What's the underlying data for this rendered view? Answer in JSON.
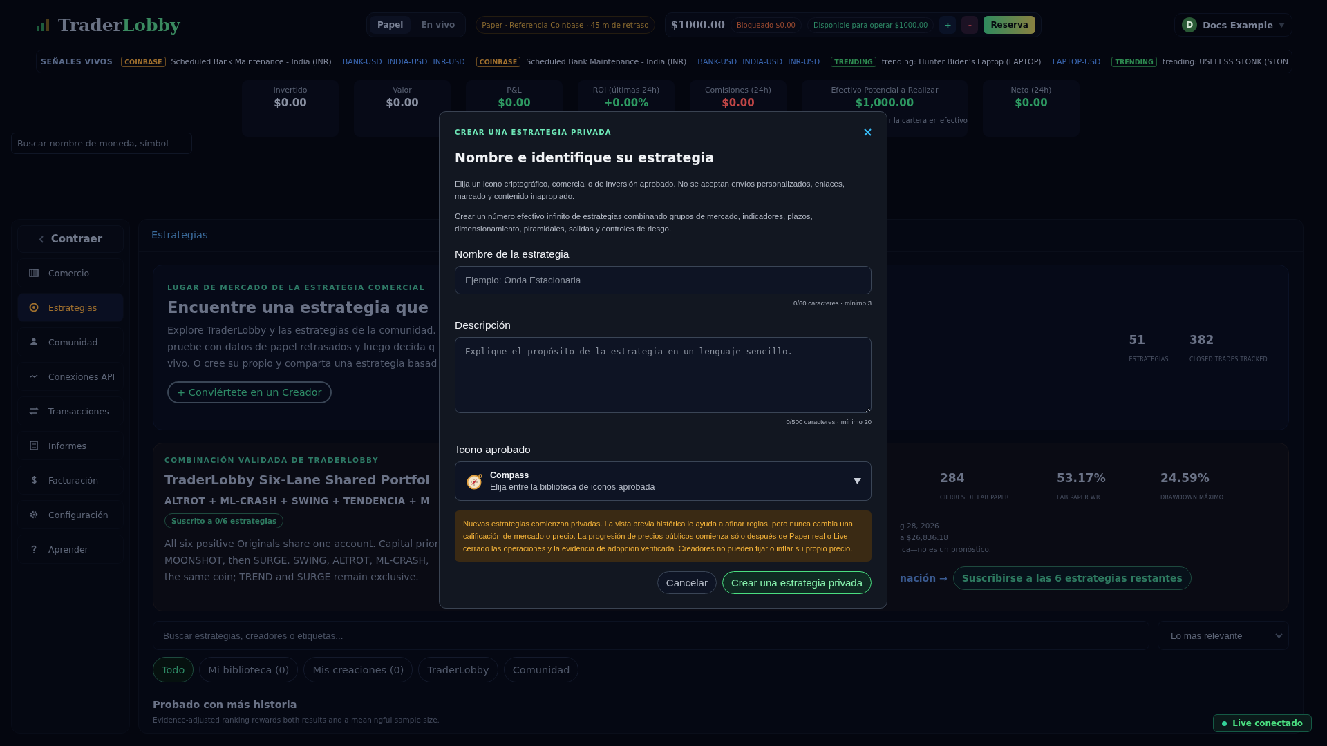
{
  "header": {
    "logo_primary": "Trader",
    "logo_secondary": "Lobby",
    "mode_tabs": [
      {
        "label": "Papel",
        "selected": true
      },
      {
        "label": "En vivo",
        "selected": false
      }
    ],
    "feed_status": "Paper · Referencia Coinbase · 45 m de retraso",
    "balance": "$1000.00",
    "locked": "Bloqueado $0.00",
    "available": "Disponible para operar $1000.00",
    "buttons": [
      {
        "label": "+",
        "kind": "deposit"
      },
      {
        "label": "-",
        "kind": "withdraw"
      },
      {
        "label": "Reserva",
        "kind": "primary"
      }
    ],
    "user": {
      "initial": "D",
      "name": "Docs Example"
    }
  },
  "ticker": {
    "label": "SEÑALES VIVOS",
    "items": [
      {
        "tag": "COINBASE",
        "kind": "coinbase",
        "text": "Scheduled Bank Maintenance - India (INR)",
        "symbols": [
          "BANK-USD",
          "INDIA-USD",
          "INR-USD"
        ]
      },
      {
        "tag": "COINBASE",
        "kind": "coinbase",
        "text": "Scheduled Bank Maintenance - India (INR)",
        "symbols": [
          "BANK-USD",
          "INDIA-USD",
          "INR-USD"
        ]
      },
      {
        "tag": "TRENDING",
        "kind": "trending",
        "text": "trending: Hunter Biden's Laptop (LAPTOP)",
        "symbols": [
          "LAPTOP-USD"
        ]
      },
      {
        "tag": "TRENDING",
        "kind": "trending",
        "text": "trending: USELESS STONK (STON"
      }
    ]
  },
  "metrics": [
    {
      "label": "Invertido",
      "value": "$0.00",
      "color": "#8a91a2"
    },
    {
      "label": "Valor",
      "value": "$0.00",
      "color": "#8a91a2"
    },
    {
      "label": "P&L",
      "value": "$0.00",
      "color": "#2e9a62"
    },
    {
      "label": "ROI (últimas 24h)",
      "value": "+0.00%",
      "color": "#2e9a62"
    },
    {
      "label": "Comisiones (24h)",
      "value": "$0.00",
      "color": "#c04646"
    },
    {
      "label": "Efectivo Potencial a Realizar",
      "value": "$1,000.00",
      "color": "#2e9a62",
      "note": "r la cartera en efectivo"
    },
    {
      "label": "Neto (24h)",
      "value": "$0.00",
      "color": "#2e9a62"
    }
  ],
  "coin_search": {
    "placeholder": "Buscar nombre de moneda, símbol"
  },
  "sidebar": {
    "collapse": "Contraer",
    "items": [
      {
        "label": "Comercio",
        "kind": "grid",
        "selected": false
      },
      {
        "label": "Estrategias",
        "kind": "target",
        "selected": true
      },
      {
        "label": "Comunidad",
        "kind": "people",
        "selected": false
      },
      {
        "label": "Conexiones API",
        "kind": "plug",
        "selected": false
      },
      {
        "label": "Transacciones",
        "kind": "swap",
        "selected": false
      },
      {
        "label": "Informes",
        "kind": "list",
        "selected": false
      },
      {
        "label": "Facturación",
        "kind": "dollar",
        "selected": false
      },
      {
        "label": "Configuración",
        "kind": "gear",
        "selected": false
      },
      {
        "label": "Aprender",
        "kind": "help",
        "selected": false
      }
    ]
  },
  "content": {
    "title": "Estrategias",
    "marketplace": {
      "eyebrow": "LUGAR DE MERCADO DE LA ESTRATEGIA COMERCIAL",
      "heading": "Encuentre una estrategia que",
      "body_lines": [
        "Explore TraderLobby y las estrategias de la comunidad.",
        "pruebe con datos de papel retrasados y luego decida q",
        "vivo. O cree su propio y comparta una estrategia basad"
      ],
      "button": "+ Conviértete en un Creador",
      "stats": [
        {
          "value": "51",
          "label": "ESTRATEGIAS"
        },
        {
          "value": "382",
          "label": "CLOSED TRADES TRACKED"
        }
      ]
    },
    "combo": {
      "eyebrow": "COMBINACIÓN VALIDADA DE TRADERLOBBY",
      "title": "TraderLobby Six-Lane Shared Portfol",
      "lanes": "ALTROT + ML-CRASH + SWING + TENDENCIA + M",
      "badge": "Suscrito a 0/6 estrategias",
      "body_lines": [
        "All six positive Originals share one account. Capital prior",
        "MOONSHOT, then SURGE. SWING, ALTROT, ML-CRASH,",
        "the same coin; TREND and SURGE remain exclusive."
      ],
      "stats": [
        {
          "value": "284",
          "label": "CIERRES DE LAB PAPER"
        },
        {
          "value": "53.17%",
          "label": "LAB PAPER WR"
        },
        {
          "value": "24.59%",
          "label": "DRAWDOWN MÁXIMO"
        }
      ],
      "fragments": [
        "g 28, 2026",
        "a $26,836.18",
        "ica—no es un pronóstico."
      ],
      "link": "nación →",
      "subscribe": "Suscribirse a las 6 estrategias restantes"
    },
    "strategy_search": {
      "placeholder": "Buscar estrategias, creadores o etiquetas..."
    },
    "sort": "Lo más relevante",
    "filters": [
      {
        "label": "Todo",
        "selected": true
      },
      {
        "label": "Mi biblioteca (0)",
        "selected": false
      },
      {
        "label": "Mis creaciones (0)",
        "selected": false
      },
      {
        "label": "TraderLobby",
        "selected": false
      },
      {
        "label": "Comunidad",
        "selected": false
      }
    ],
    "section": {
      "title": "Probado con más historia",
      "subtitle": "Evidence-adjusted ranking rewards both results and a meaningful sample size."
    }
  },
  "connection": {
    "label": "Live conectado",
    "connected": true
  },
  "modal": {
    "eyebrow": "CREAR UNA ESTRATEGIA PRIVADA",
    "title": "Nombre e identifique su estrategia",
    "paragraphs": [
      "Elija un icono criptográfico, comercial o de inversión aprobado. No se aceptan envíos personalizados, enlaces, marcado y contenido inapropiado.",
      "Crear un número efectivo infinito de estrategias combinando grupos de mercado, indicadores, plazos, dimensionamiento, piramidales, salidas y controles de riesgo."
    ],
    "name_field": {
      "label": "Nombre de la estrategia",
      "placeholder": "Ejemplo: Onda Estacionaria",
      "counter": "0/60 caracteres · mínimo 3"
    },
    "description_field": {
      "label": "Descripción",
      "placeholder": "Explique el propósito de la estrategia en un lenguaje sencillo.",
      "counter": "0/500 caracteres · mínimo 20"
    },
    "icon_field": {
      "label": "Icono aprobado",
      "value": "Compass",
      "hint": "Elija entre la biblioteca de iconos aprobada"
    },
    "notice": "Nuevas estrategias comienzan privadas. La vista previa histórica le ayuda a afinar reglas, pero nunca cambia una calificación de mercado o precio. La progresión de precios públicos comienza sólo después de Paper real o Live cerrado las operaciones y la evidencia de adopción verificada. Creadores no pueden fijar o inflar su propio precio.",
    "cancel": "Cancelar",
    "submit": "Crear una estrategia privada"
  }
}
